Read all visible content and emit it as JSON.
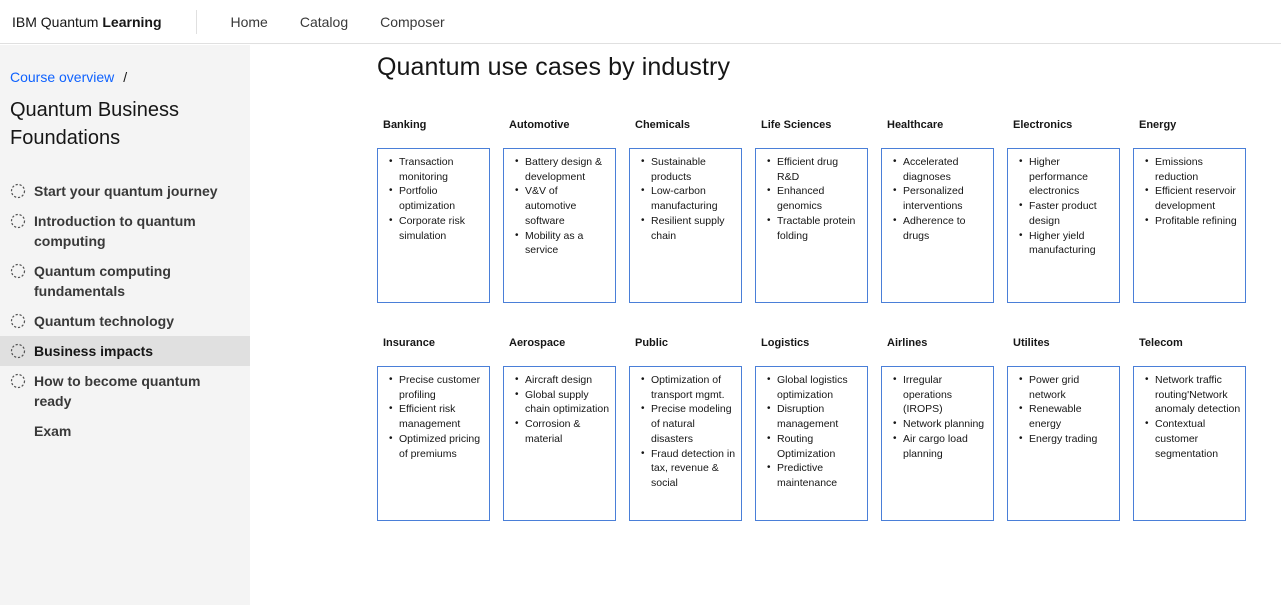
{
  "header": {
    "brand_regular": "IBM Quantum",
    "brand_bold": "Learning",
    "nav": [
      "Home",
      "Catalog",
      "Composer"
    ]
  },
  "sidebar": {
    "breadcrumb_link": "Course overview",
    "breadcrumb_sep": "/",
    "course_title": "Quantum Business Foundations",
    "lessons": [
      {
        "label": "Start your quantum journey",
        "status_icon": "dashed-circle-icon"
      },
      {
        "label": "Introduction to quantum computing",
        "status_icon": "dashed-circle-icon"
      },
      {
        "label": "Quantum computing fundamentals",
        "status_icon": "dashed-circle-icon"
      },
      {
        "label": "Quantum technology",
        "status_icon": "dashed-circle-icon"
      },
      {
        "label": "Business impacts",
        "status_icon": "dashed-circle-icon",
        "active": true
      },
      {
        "label": "How to become quantum ready",
        "status_icon": "dashed-circle-icon"
      },
      {
        "label": "Exam",
        "status_icon": ""
      }
    ]
  },
  "main": {
    "title": "Quantum use cases by industry",
    "accent_color": "#4a7fd8",
    "industries": [
      {
        "name": "Banking",
        "items": [
          "Transaction monitoring",
          "Portfolio optimization",
          "Corporate risk simulation"
        ]
      },
      {
        "name": "Automotive",
        "items": [
          "Battery design & development",
          "V&V of automotive software",
          "Mobility as a service"
        ]
      },
      {
        "name": "Chemicals",
        "items": [
          "Sustainable products",
          "Low-carbon manufacturing",
          "Resilient supply chain"
        ]
      },
      {
        "name": "Life Sciences",
        "items": [
          "Efficient drug R&D",
          "Enhanced genomics",
          "Tractable protein folding"
        ]
      },
      {
        "name": "Healthcare",
        "items": [
          "Accelerated diagnoses",
          "Personalized interventions",
          "Adherence to drugs"
        ]
      },
      {
        "name": "Electronics",
        "items": [
          "Higher performance electronics",
          "Faster product design",
          "Higher yield manufacturing"
        ]
      },
      {
        "name": "Energy",
        "items": [
          "Emissions reduction",
          "Efficient reservoir development",
          "Profitable refining"
        ]
      },
      {
        "name": "Insurance",
        "items": [
          "Precise customer profiling",
          "Efficient risk management",
          "Optimized pricing of premiums"
        ]
      },
      {
        "name": "Aerospace",
        "items": [
          "Aircraft design",
          "Global supply chain optimization",
          "Corrosion & material"
        ]
      },
      {
        "name": "Public",
        "items": [
          "Optimization of transport mgmt.",
          "Precise modeling of natural disasters",
          "Fraud detection in tax, revenue & social"
        ]
      },
      {
        "name": "Logistics",
        "items": [
          "Global logistics optimization",
          "Disruption management",
          "Routing Optimization",
          "Predictive maintenance"
        ]
      },
      {
        "name": "Airlines",
        "items": [
          "Irregular operations (IROPS)",
          "Network planning",
          "Air cargo load planning"
        ]
      },
      {
        "name": "Utilites",
        "items": [
          "Power grid network",
          "Renewable energy",
          "Energy trading"
        ]
      },
      {
        "name": "Telecom",
        "items": [
          "Network traffic routing'Network anomaly detection",
          "Contextual customer segmentation"
        ]
      }
    ]
  }
}
